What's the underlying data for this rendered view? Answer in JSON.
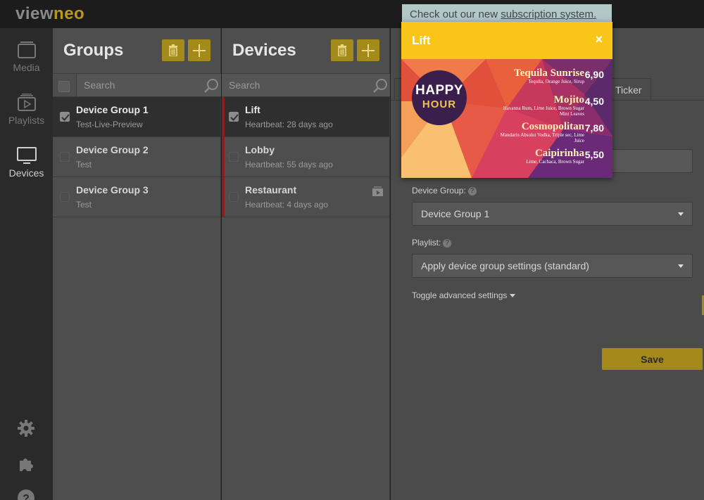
{
  "app": {
    "logo_part1": "view",
    "logo_part2": "neo"
  },
  "nav": {
    "items": [
      {
        "label": "Media",
        "icon": "media-icon",
        "active": false
      },
      {
        "label": "Playlists",
        "icon": "playlist-icon",
        "active": false
      },
      {
        "label": "Devices",
        "icon": "monitor-icon",
        "active": true
      }
    ],
    "bottom_icons": [
      "gear-icon",
      "puzzle-icon",
      "help-icon"
    ]
  },
  "groups": {
    "title": "Groups",
    "search_placeholder": "Search",
    "items": [
      {
        "name": "Device Group 1",
        "sub": "Test-Live-Preview",
        "selected": true
      },
      {
        "name": "Device Group 2",
        "sub": "Test",
        "selected": false
      },
      {
        "name": "Device Group 3",
        "sub": "Test",
        "selected": false
      }
    ]
  },
  "devices": {
    "title": "Devices",
    "search_placeholder": "Search",
    "items": [
      {
        "name": "Lift",
        "sub": "Heartbeat: 28 days ago",
        "selected": true,
        "status": "offline"
      },
      {
        "name": "Lobby",
        "sub": "Heartbeat: 55 days ago",
        "selected": false,
        "status": "offline"
      },
      {
        "name": "Restaurant",
        "sub": "Heartbeat: 4 days ago",
        "selected": false,
        "status": "offline",
        "icon": "playlist-icon"
      }
    ]
  },
  "detail": {
    "tab_ticker": "Ticker",
    "device_group_label": "Device Group:",
    "device_group_value": "Device Group 1",
    "playlist_label": "Playlist:",
    "playlist_value": "Apply device group settings (standard)",
    "advanced_label": "Toggle advanced settings",
    "save_label": "Save"
  },
  "notice": {
    "text_before": "Check out our new ",
    "link": "subscription system."
  },
  "preview": {
    "title": "Lift",
    "close": "×",
    "badge_line1": "HAPPY",
    "badge_line2": "HOUR",
    "menu": [
      {
        "name": "Tequila Sunrise",
        "desc": "Tequila, Orange Juice, Sirup",
        "price": "6,90"
      },
      {
        "name": "Mojito",
        "desc": "Havanna Rum, Lime Juice, Brown Sugar Mint Leaves",
        "price": "4,50"
      },
      {
        "name": "Cosmopolitan",
        "desc": "Mandarin Absolut Vodka, Triple sec, Lime Juice",
        "price": "7,80"
      },
      {
        "name": "Caipirinha",
        "desc": "Lime, Cachaca, Brown Sugar",
        "price": "5,50"
      }
    ]
  },
  "colors": {
    "accent": "#a38a1b",
    "popup_header": "#f9c518",
    "offline_bar": "#8c1c22"
  }
}
